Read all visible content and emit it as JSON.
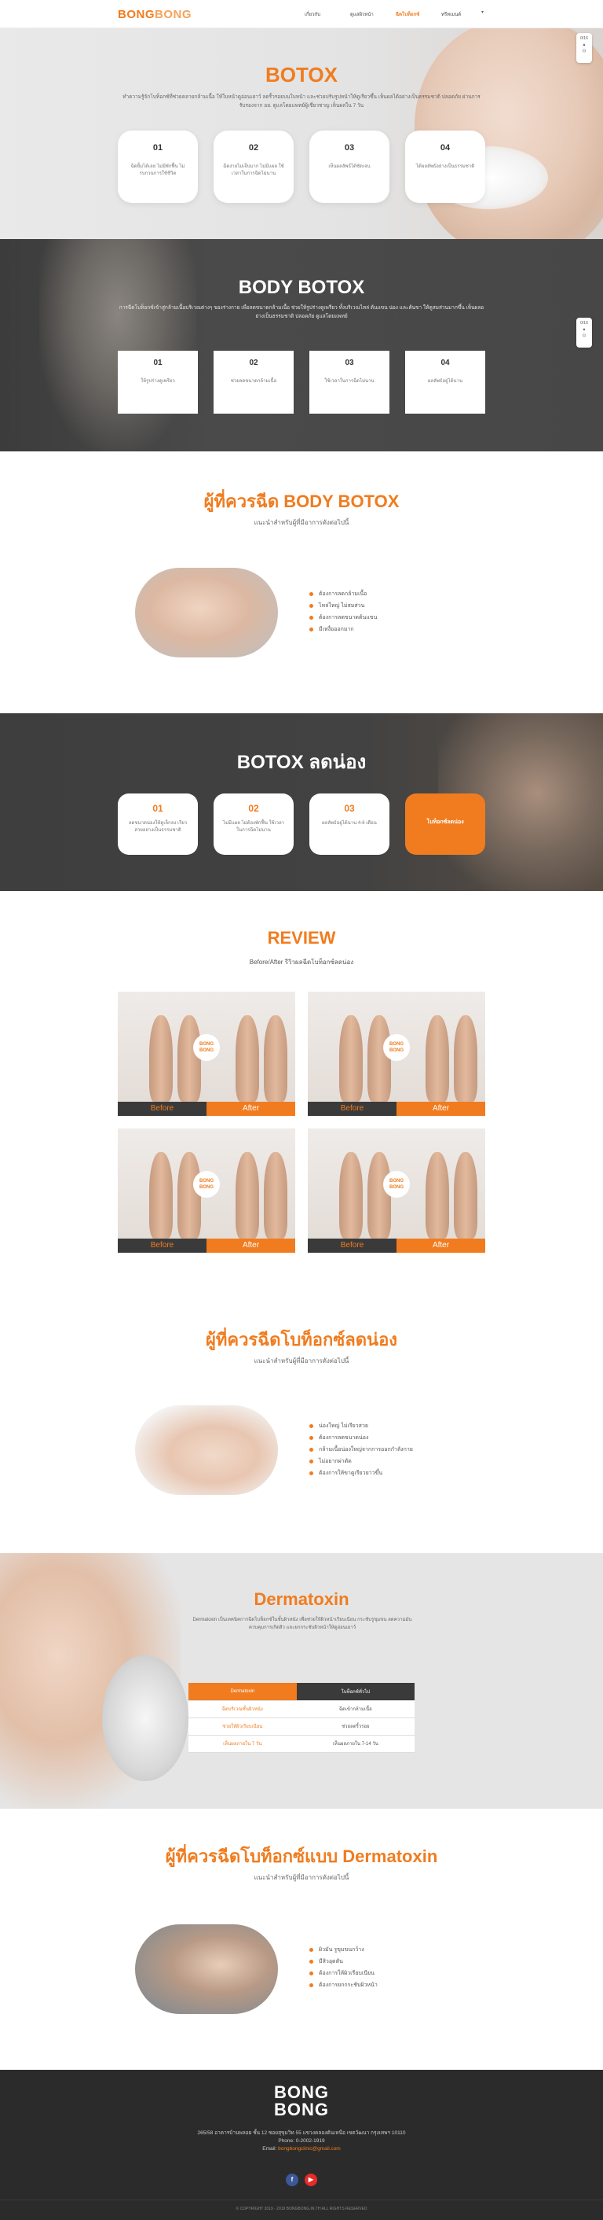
{
  "nav": {
    "logo_a": "BONG",
    "logo_b": "BONG",
    "links": [
      "เกี่ยวกับ",
      "ดูแลผิวหน้า",
      "ฉีดโบท็อกซ์",
      "ทรีทเมนต์"
    ],
    "caret": "▾"
  },
  "hero": {
    "title": "BOTOX",
    "lead": "ทำความรู้จักโบท็อกซ์ที่ช่วยคลายกล้ามเนื้อ ให้ใบหน้าดูอ่อนเยาว์ ลดริ้วรอยบนใบหน้า และช่วยปรับรูปหน้าให้ดูเรียวขึ้น เห็นผลได้อย่างเป็นธรรมชาติ ปลอดภัย ผ่านการรับรองจาก อย. ดูแลโดยแพทย์ผู้เชี่ยวชาญ เห็นผลใน 7 วัน",
    "cards": [
      {
        "num": "01",
        "text": "ฉีดยิ้มได้เลย ไม่มีพักฟื้น ไม่รบกวนการใช้ชีวิต"
      },
      {
        "num": "02",
        "text": "ฉีดง่ายไม่เจ็บมาก ไม่มีแผล ใช้เวลาในการฉีดไม่นาน"
      },
      {
        "num": "03",
        "text": "เห็นผลลัพธ์ได้ชัดเจน"
      },
      {
        "num": "04",
        "text": "ได้ผลลัพธ์อย่างเป็นธรรมชาติ"
      }
    ]
  },
  "floater": {
    "top": "0/16",
    "mid": "▲",
    "bottom": "⊡"
  },
  "body_botox": {
    "title": "BODY BOTOX",
    "lead": "การฉีดโบท็อกซ์เข้าสู่กล้ามเนื้อบริเวณต่างๆ ของร่างกาย เพื่อลดขนาดกล้ามเนื้อ ช่วยให้รูปร่างดูเพรียว ทั้งบริเวณไหล่ ต้นแขน น่อง และต้นขา ให้ดูสมส่วนมากขึ้น เห็นผลอย่างเป็นธรรมชาติ ปลอดภัย ดูแลโดยแพทย์",
    "cards": [
      {
        "num": "01",
        "text": "ให้รูปร่างดูเพรียว"
      },
      {
        "num": "02",
        "text": "ช่วยลดขนาดกล้ามเนื้อ"
      },
      {
        "num": "03",
        "text": "ใช้เวลาในการฉีดไม่นาน"
      },
      {
        "num": "04",
        "text": "ผลลัพธ์อยู่ได้นาน"
      }
    ]
  },
  "who_body": {
    "title": "ผู้ที่ควรฉีด BODY BOTOX",
    "subtitle": "แนะนำสำหรับผู้ที่มีอาการดังต่อไปนี้",
    "items": [
      "ต้องการลดกล้ามเนื้อ",
      "ไหล่ใหญ่ ไม่สมส่วน",
      "ต้องการลดขนาดต้นแขน",
      "มีเหงื่อออกมาก"
    ]
  },
  "calf": {
    "title": "BOTOX ลดน่อง",
    "cards": [
      {
        "num": "01",
        "text": "ลดขนาดน่องให้ดูเล็กลง เรียวสวยอย่างเป็นธรรมชาติ"
      },
      {
        "num": "02",
        "text": "ไม่มีแผล ไม่ต้องพักฟื้น ใช้เวลาในการฉีดไม่นาน"
      },
      {
        "num": "03",
        "text": "ผลลัพธ์อยู่ได้นาน 4-6 เดือน"
      }
    ],
    "cta": "โบท็อกซ์ลดน่อง"
  },
  "review": {
    "title": "REVIEW",
    "subtitle": "Before/After รีวิวผลฉีดโบท็อกซ์ลดน่อง",
    "before": "Before",
    "after": "After",
    "badge": "BONG BONG"
  },
  "who_calf": {
    "title": "ผู้ที่ควรฉีดโบท็อกซ์ลดน่อง",
    "subtitle": "แนะนำสำหรับผู้ที่มีอาการดังต่อไปนี้",
    "items": [
      "น่องใหญ่ ไม่เรียวสวย",
      "ต้องการลดขนาดน่อง",
      "กล้ามเนื้อน่องใหญ่จากการออกกำลังกาย",
      "ไม่อยากผ่าตัด",
      "ต้องการให้ขาดูเรียวยาวขึ้น"
    ]
  },
  "derma": {
    "title": "Dermatoxin",
    "lead": "Dermatoxin เป็นเทคนิคการฉีดโบท็อกซ์ในชั้นผิวหนัง เพื่อช่วยให้ผิวหน้าเรียบเนียน กระชับรูขุมขน ลดความมัน ควบคุมการเกิดสิว และยกกระชับผิวหน้าให้ดูอ่อนเยาว์",
    "table": {
      "head": [
        "Dermatoxin",
        "โบท็อกซ์ทั่วไป"
      ],
      "rows": [
        [
          "ฉีดบริเวณชั้นผิวหนัง",
          "ฉีดเข้ากล้ามเนื้อ"
        ],
        [
          "ช่วยให้ผิวเรียบเนียน",
          "ช่วยลดริ้วรอย"
        ],
        [
          "เห็นผลภายใน 7 วัน",
          "เห็นผลภายใน 7-14 วัน"
        ]
      ]
    }
  },
  "who_derma": {
    "title": "ผู้ที่ควรฉีดโบท็อกซ์แบบ Dermatoxin",
    "subtitle": "แนะนำสำหรับผู้ที่มีอาการดังต่อไปนี้",
    "items": [
      "ผิวมัน รูขุมขนกว้าง",
      "มีสิวอุดตัน",
      "ต้องการให้ผิวเรียบเนียน",
      "ต้องการยกกระชับผิวหน้า"
    ]
  },
  "footer": {
    "logo_top": "BONG",
    "logo_bottom": "BONG",
    "address": "265/58 อาคารบ้านพลอย ชั้น 12 ซอยสุขุมวิท 55 แขวงคลองตันเหนือ เขตวัฒนา กรุงเทพฯ 10110",
    "phone": "Phone: 0-2002-1919",
    "email_label": "Email:",
    "email": "bongbongclinic@gmail.com",
    "copyright": "© COPYRIGHT 2019 - 2019 BONGBONG.IN.TH ALL RIGHTS RESERVED",
    "facebook": "f",
    "youtube": "▶"
  },
  "colors": {
    "accent": "#f07c1f",
    "dark": "#3a3a3a",
    "facebook": "#3b5998",
    "youtube": "#e52d27"
  }
}
